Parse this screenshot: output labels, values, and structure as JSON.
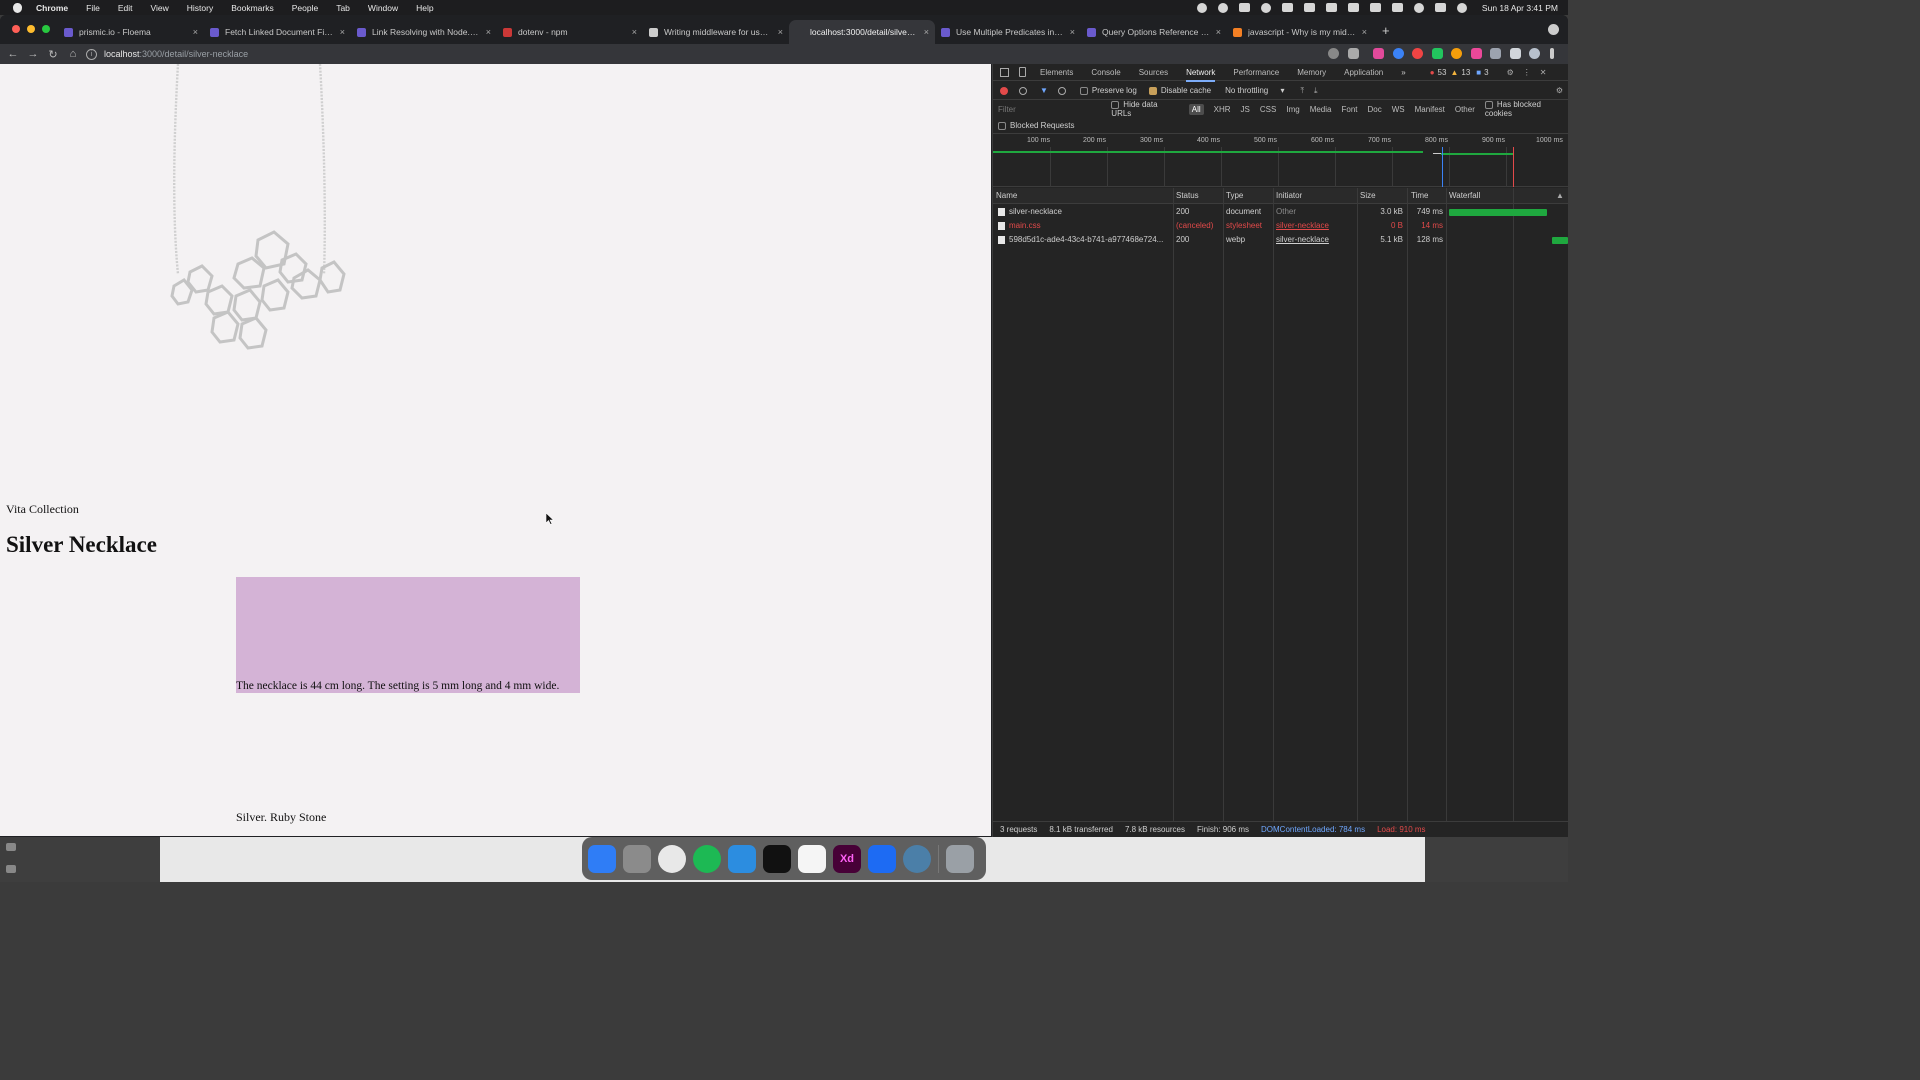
{
  "menubar": {
    "app": "Chrome",
    "items": [
      "File",
      "Edit",
      "View",
      "History",
      "Bookmarks",
      "People",
      "Tab",
      "Window",
      "Help"
    ],
    "clock": "Sun 18 Apr  3:41 PM"
  },
  "tabs": [
    {
      "title": "prismic.io - Floema",
      "favicon_color": "#6a5acd"
    },
    {
      "title": "Fetch Linked Document Fields",
      "favicon_color": "#6a5acd"
    },
    {
      "title": "Link Resolving with Node.js - P",
      "favicon_color": "#6a5acd"
    },
    {
      "title": "dotenv - npm",
      "favicon_color": "#cb3837"
    },
    {
      "title": "Writing middleware for use in E",
      "favicon_color": "#cccccc"
    },
    {
      "title": "localhost:3000/detail/silver-ne",
      "favicon_color": "#35363a",
      "active": true
    },
    {
      "title": "Use Multiple Predicates in Java",
      "favicon_color": "#6a5acd"
    },
    {
      "title": "Query Options Reference in Ja",
      "favicon_color": "#6a5acd"
    },
    {
      "title": "javascript - Why is my middlew",
      "favicon_color": "#f48024"
    }
  ],
  "address": {
    "host": "localhost",
    "path": ":3000/detail/silver-necklace"
  },
  "page": {
    "collection": "Vita Collection",
    "title": "Silver Necklace",
    "description": "The necklace is 44 cm long. The setting is 5 mm long and 4 mm wide.",
    "swatch_color": "#d4b3d6",
    "material": "Silver. Ruby Stone"
  },
  "devtools": {
    "tabs": [
      "Elements",
      "Console",
      "Sources",
      "Network",
      "Performance",
      "Memory",
      "Application"
    ],
    "active_tab": "Network",
    "errors": "53",
    "warnings": "13",
    "info": "3",
    "preserve_log": "Preserve log",
    "disable_cache": "Disable cache",
    "throttling": "No throttling",
    "filter_placeholder": "Filter",
    "hide_data_urls": "Hide data URLs",
    "filter_types": [
      "All",
      "XHR",
      "JS",
      "CSS",
      "Img",
      "Media",
      "Font",
      "Doc",
      "WS",
      "Manifest",
      "Other"
    ],
    "has_blocked_cookies": "Has blocked cookies",
    "blocked_requests": "Blocked Requests",
    "timeline_ticks": [
      "100 ms",
      "200 ms",
      "300 ms",
      "400 ms",
      "500 ms",
      "600 ms",
      "700 ms",
      "800 ms",
      "900 ms",
      "1000 ms"
    ],
    "columns": [
      "Name",
      "Status",
      "Type",
      "Initiator",
      "Size",
      "Time",
      "Waterfall"
    ],
    "requests": [
      {
        "name": "silver-necklace",
        "status": "200",
        "type": "document",
        "initiator": "Other",
        "size": "3.0 kB",
        "time": "749 ms",
        "canceled": false
      },
      {
        "name": "main.css",
        "status": "(canceled)",
        "type": "stylesheet",
        "initiator": "silver-necklace",
        "size": "0 B",
        "time": "14 ms",
        "canceled": true
      },
      {
        "name": "598d5d1c-ade4-43c4-b741-a977468e724...",
        "status": "200",
        "type": "webp",
        "initiator": "silver-necklace",
        "size": "5.1 kB",
        "time": "128 ms",
        "canceled": false
      }
    ],
    "status_bar": {
      "requests": "3 requests",
      "transferred": "8.1 kB transferred",
      "resources": "7.8 kB resources",
      "finish": "Finish: 906 ms",
      "dcl": "DOMContentLoaded: 784 ms",
      "load": "Load: 910 ms"
    }
  },
  "dock": {
    "items": [
      "finder",
      "launchpad",
      "chrome",
      "spotify",
      "vscode",
      "terminal",
      "slack",
      "adobe-xd",
      "maps-pin",
      "quicktime",
      "trash"
    ],
    "xd_label": "Xd"
  },
  "colors": {
    "waterfall_bar": "#1fa83f",
    "error_red": "#e34a4a",
    "dcl_blue": "#6fa7ff"
  }
}
